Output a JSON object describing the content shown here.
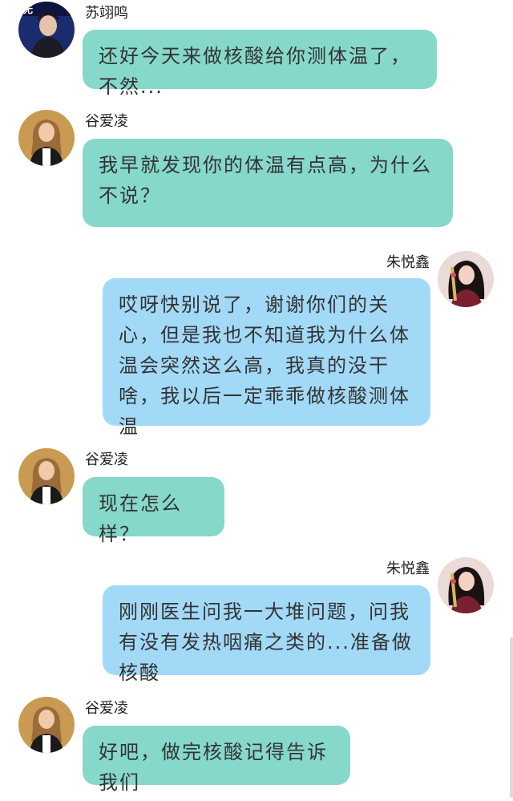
{
  "messages": [
    {
      "sender": "苏翊鸣",
      "text": "还好今天来做核酸给你测体温了，不然...",
      "side": "left",
      "color": "teal",
      "avatar": "avatar-su"
    },
    {
      "sender": "谷爱凌",
      "text": "我早就发现你的体温有点高，为什么不说？",
      "side": "left",
      "color": "teal",
      "avatar": "avatar-gu"
    },
    {
      "sender": "朱悦鑫",
      "text": "哎呀快别说了，谢谢你们的关心，但是我也不知道我为什么体温会突然这么高，我真的没干啥，我以后一定乖乖做核酸测体温",
      "side": "right",
      "color": "blue",
      "avatar": "avatar-zhu"
    },
    {
      "sender": "谷爱凌",
      "text": "现在怎么样？",
      "side": "left",
      "color": "teal",
      "avatar": "avatar-gu"
    },
    {
      "sender": "朱悦鑫",
      "text": "刚刚医生问我一大堆问题，问我有没有发热咽痛之类的...准备做核酸",
      "side": "right",
      "color": "blue",
      "avatar": "avatar-zhu"
    },
    {
      "sender": "谷爱凌",
      "text": "好吧，做完核酸记得告诉我们",
      "side": "left",
      "color": "teal",
      "avatar": "avatar-gu"
    }
  ],
  "colors": {
    "teal": "#86d8cb",
    "blue": "#a2d9f7"
  }
}
